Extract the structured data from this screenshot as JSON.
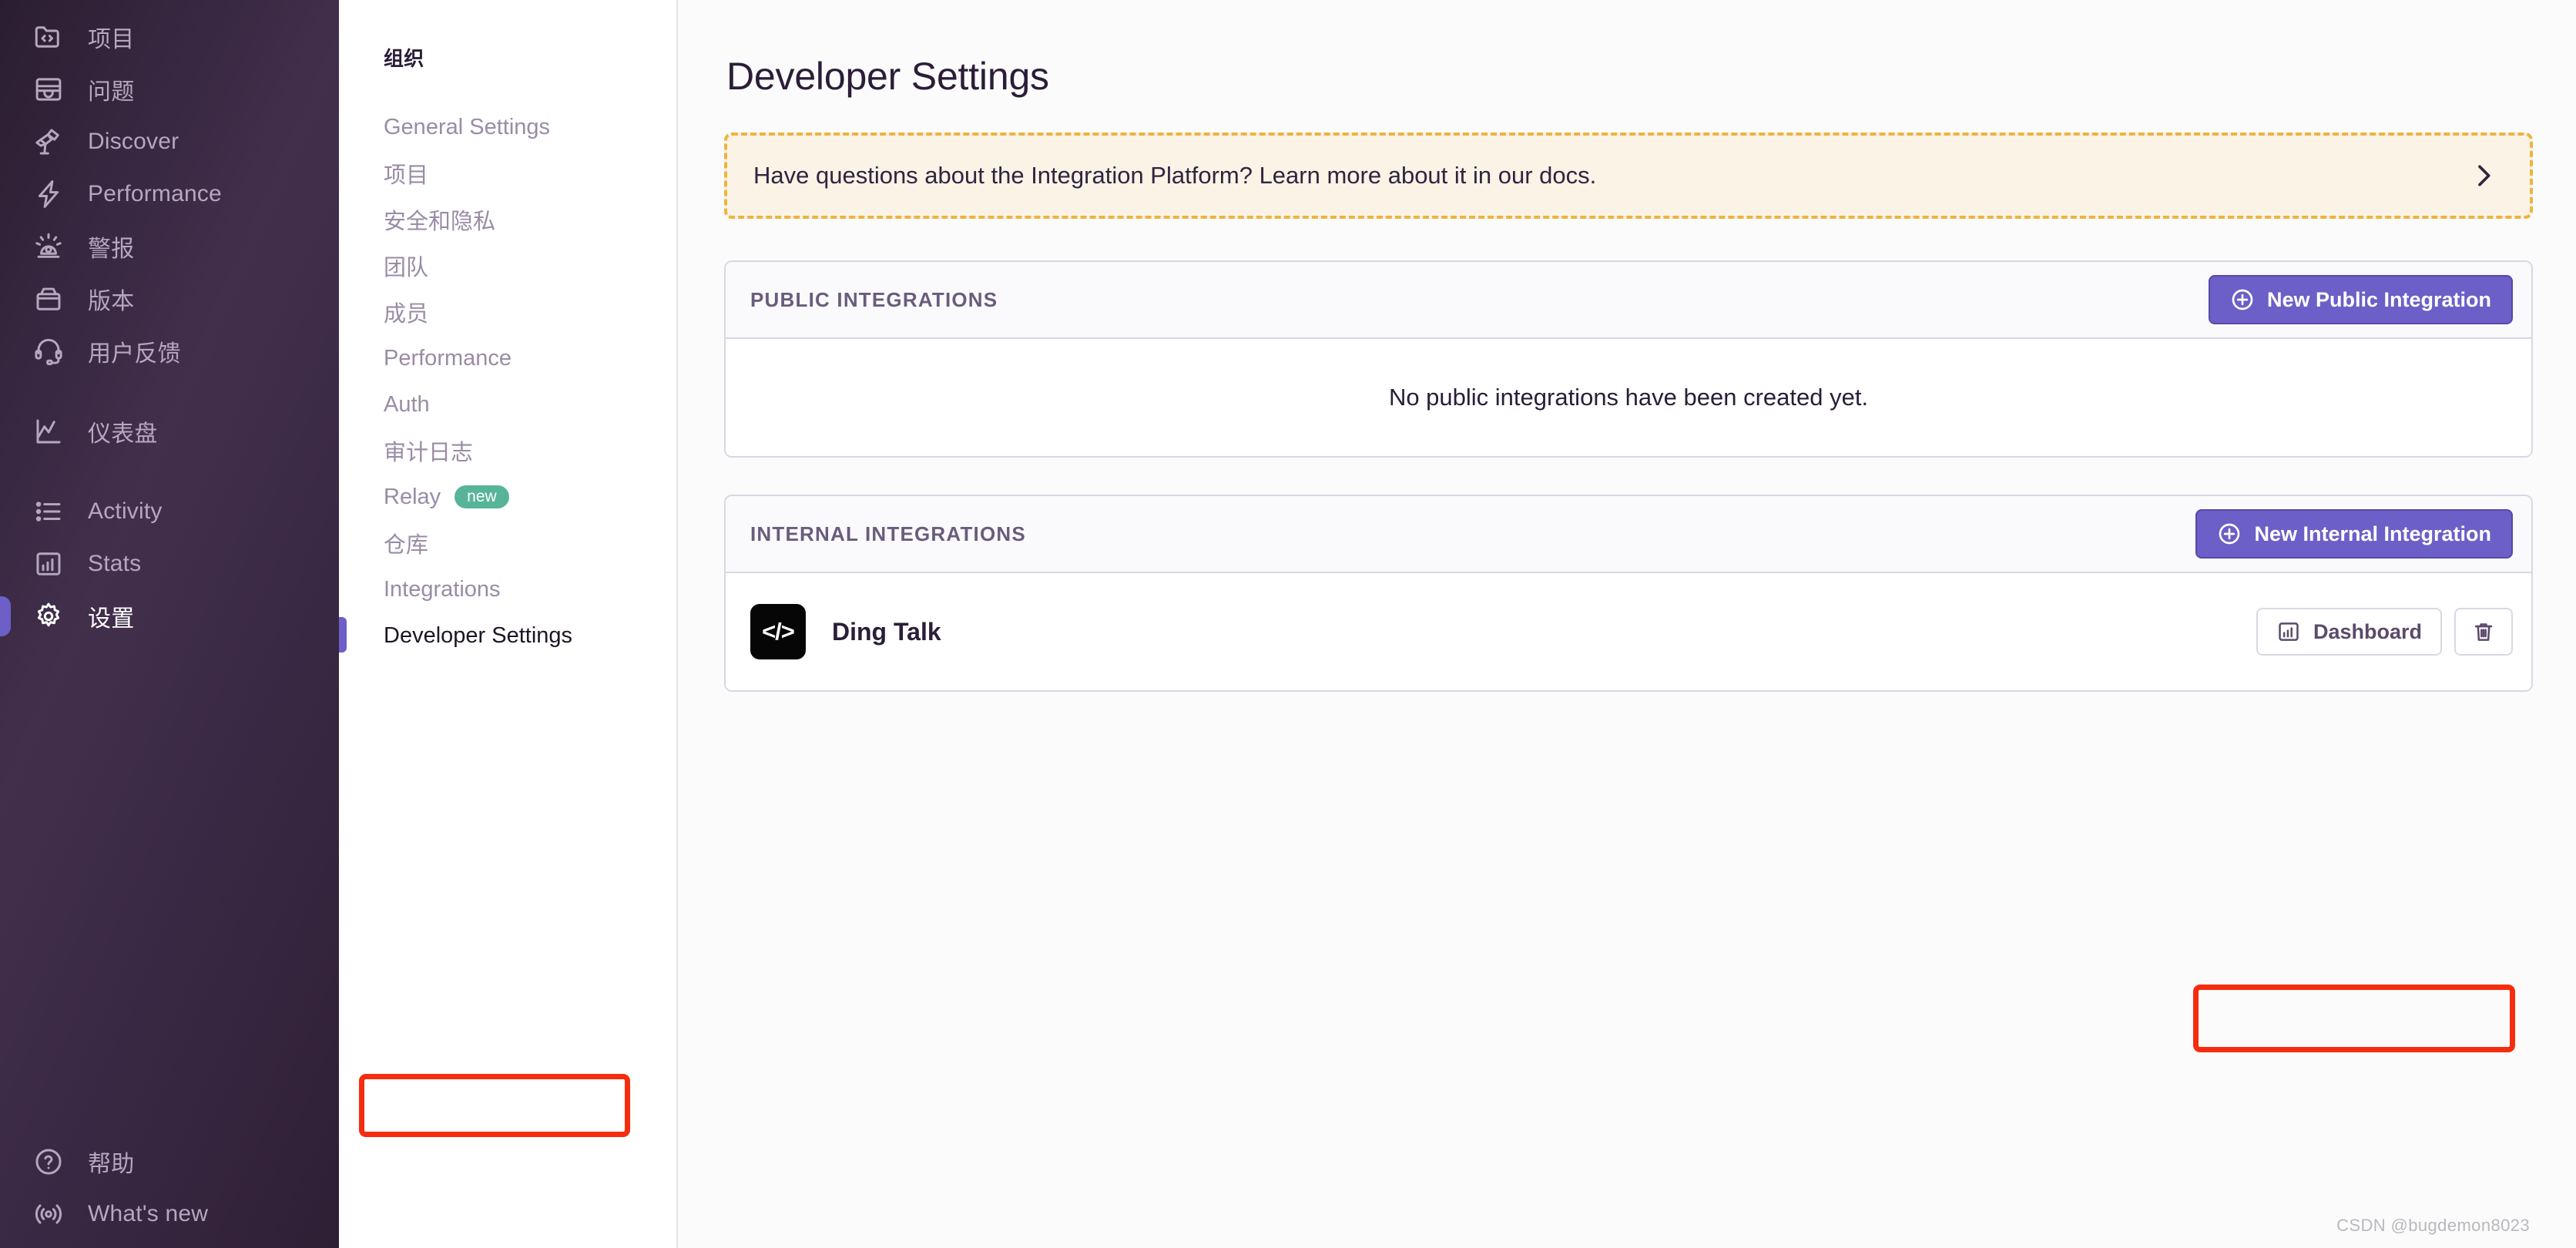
{
  "sidebar": {
    "items": [
      {
        "label": "项目",
        "icon": "code-folder-icon",
        "active": false
      },
      {
        "label": "问题",
        "icon": "issues-icon",
        "active": false
      },
      {
        "label": "Discover",
        "icon": "telescope-icon",
        "active": false
      },
      {
        "label": "Performance",
        "icon": "lightning-icon",
        "active": false
      },
      {
        "label": "警报",
        "icon": "siren-icon",
        "active": false
      },
      {
        "label": "版本",
        "icon": "releases-icon",
        "active": false
      },
      {
        "label": "用户反馈",
        "icon": "support-headset-icon",
        "active": false
      },
      {
        "label": "仪表盘",
        "icon": "line-chart-icon",
        "active": false
      },
      {
        "label": "Activity",
        "icon": "list-icon",
        "active": false
      },
      {
        "label": "Stats",
        "icon": "bar-chart-icon",
        "active": false
      },
      {
        "label": "设置",
        "icon": "gear-icon",
        "active": true
      }
    ],
    "bottom_items": [
      {
        "label": "帮助",
        "icon": "question-circle-icon"
      },
      {
        "label": "What's new",
        "icon": "broadcast-icon"
      }
    ]
  },
  "settings_nav": {
    "heading": "组织",
    "items": [
      {
        "label": "General Settings",
        "active": false
      },
      {
        "label": "项目",
        "active": false
      },
      {
        "label": "安全和隐私",
        "active": false
      },
      {
        "label": "团队",
        "active": false
      },
      {
        "label": "成员",
        "active": false
      },
      {
        "label": "Performance",
        "active": false
      },
      {
        "label": "Auth",
        "active": false
      },
      {
        "label": "审计日志",
        "active": false
      },
      {
        "label": "Relay",
        "active": false,
        "badge": "new"
      },
      {
        "label": "仓库",
        "active": false
      },
      {
        "label": "Integrations",
        "active": false
      },
      {
        "label": "Developer Settings",
        "active": true
      }
    ]
  },
  "main": {
    "page_title": "Developer Settings",
    "docs_banner": {
      "text": "Have questions about the Integration Platform? Learn more about it in our docs.",
      "chevron_icon": "chevron-right-icon"
    },
    "public_panel": {
      "title": "PUBLIC INTEGRATIONS",
      "button_label": "New Public Integration",
      "button_icon": "plus-circle-icon",
      "empty_text": "No public integrations have been created yet."
    },
    "internal_panel": {
      "title": "INTERNAL INTEGRATIONS",
      "button_label": "New Internal Integration",
      "button_icon": "plus-circle-icon",
      "rows": [
        {
          "name": "Ding Talk",
          "icon_glyph": "</>",
          "dashboard_label": "Dashboard",
          "dashboard_icon": "bar-chart-icon",
          "delete_icon": "trash-icon"
        }
      ]
    }
  },
  "watermark": "CSDN @bugdemon8023",
  "colors": {
    "accent_purple": "#6c5fc7",
    "banner_bg": "#faf3e6",
    "banner_border": "#eeb33f",
    "badge_green": "#57b498",
    "annotation_red": "#f52d0e"
  }
}
